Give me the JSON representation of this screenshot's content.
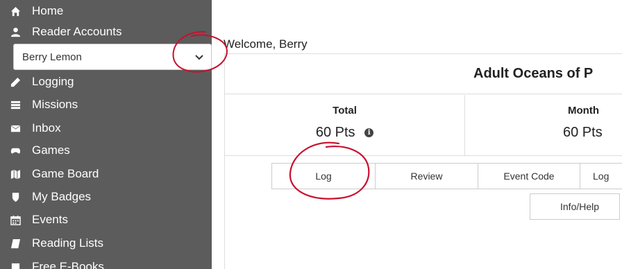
{
  "sidebar": {
    "items": [
      {
        "label": "Home",
        "icon": "home-icon"
      },
      {
        "label": "Reader Accounts",
        "icon": "user-icon"
      },
      {
        "label": "Logging",
        "icon": "pencil-icon"
      },
      {
        "label": "Missions",
        "icon": "missions-icon"
      },
      {
        "label": "Inbox",
        "icon": "envelope-icon"
      },
      {
        "label": "Games",
        "icon": "gamepad-icon"
      },
      {
        "label": "Game Board",
        "icon": "map-icon"
      },
      {
        "label": "My Badges",
        "icon": "shield-icon"
      },
      {
        "label": "Events",
        "icon": "calendar-icon"
      },
      {
        "label": "Reading Lists",
        "icon": "book-icon"
      },
      {
        "label": "Free E-Books",
        "icon": "ebook-icon"
      }
    ],
    "reader_select": {
      "value": "Berry Lemon"
    }
  },
  "main": {
    "welcome": "Welcome,  Berry",
    "program_title": "Adult Oceans of P",
    "stats": {
      "total_label": "Total",
      "total_value": "60 Pts",
      "month_label": "Month",
      "month_value": "60 Pts"
    },
    "info_glyph": "i",
    "buttons": {
      "log": "Log",
      "review": "Review",
      "event_code": "Event Code",
      "log_more": "Log",
      "info_help": "Info/Help"
    }
  },
  "colors": {
    "sidebar_bg": "#5c5c5c",
    "annotation_red": "#c8102e"
  }
}
